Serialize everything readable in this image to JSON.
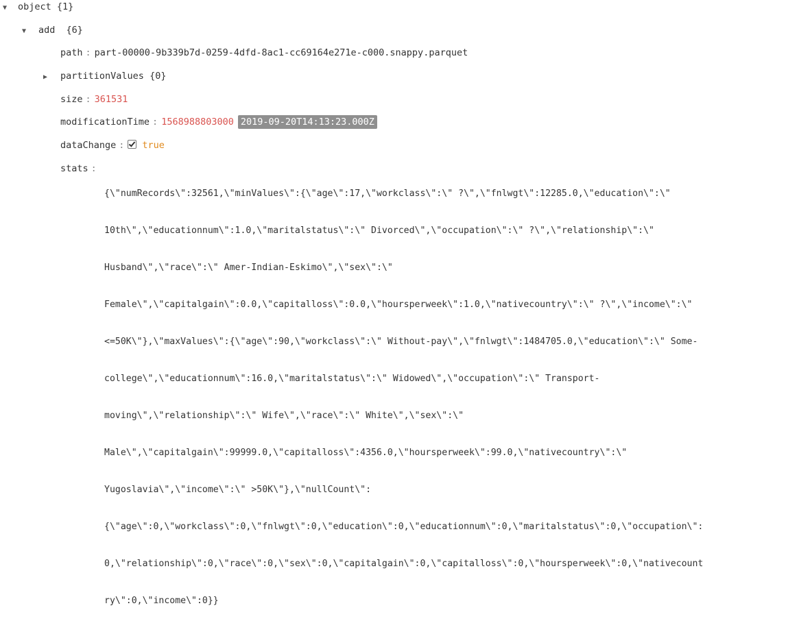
{
  "tree": {
    "root": {
      "key": "object",
      "count": "{1}"
    },
    "add": {
      "key": "add",
      "count": "{6}"
    },
    "path": {
      "key": "path",
      "value": "part-00000-9b339b7d-0259-4dfd-8ac1-cc69164e271e-c000.snappy.parquet"
    },
    "partitionValues": {
      "key": "partitionValues",
      "count": "{0}"
    },
    "size": {
      "key": "size",
      "value": "361531"
    },
    "modificationTime": {
      "key": "modificationTime",
      "value": "1568988803000",
      "date": "2019-09-20T14:13:23.000Z"
    },
    "dataChange": {
      "key": "dataChange",
      "value": "true",
      "checked": true
    },
    "stats": {
      "key": "stats",
      "lines": [
        "{\\\"numRecords\\\":32561,\\\"minValues\\\":{\\\"age\\\":17,\\\"workclass\\\":\\\" ?\\\",\\\"fnlwgt\\\":12285.0,\\\"education\\\":\\\"",
        "10th\\\",\\\"educationnum\\\":1.0,\\\"maritalstatus\\\":\\\" Divorced\\\",\\\"occupation\\\":\\\" ?\\\",\\\"relationship\\\":\\\"",
        "Husband\\\",\\\"race\\\":\\\" Amer-Indian-Eskimo\\\",\\\"sex\\\":\\\"",
        "Female\\\",\\\"capitalgain\\\":0.0,\\\"capitalloss\\\":0.0,\\\"hoursperweek\\\":1.0,\\\"nativecountry\\\":\\\" ?\\\",\\\"income\\\":\\\"",
        "<=50K\\\"},\\\"maxValues\\\":{\\\"age\\\":90,\\\"workclass\\\":\\\" Without-pay\\\",\\\"fnlwgt\\\":1484705.0,\\\"education\\\":\\\" Some-",
        "college\\\",\\\"educationnum\\\":16.0,\\\"maritalstatus\\\":\\\" Widowed\\\",\\\"occupation\\\":\\\" Transport-",
        "moving\\\",\\\"relationship\\\":\\\" Wife\\\",\\\"race\\\":\\\" White\\\",\\\"sex\\\":\\\"",
        "Male\\\",\\\"capitalgain\\\":99999.0,\\\"capitalloss\\\":4356.0,\\\"hoursperweek\\\":99.0,\\\"nativecountry\\\":\\\"",
        "Yugoslavia\\\",\\\"income\\\":\\\" >50K\\\"},\\\"nullCount\\\":",
        "{\\\"age\\\":0,\\\"workclass\\\":0,\\\"fnlwgt\\\":0,\\\"education\\\":0,\\\"educationnum\\\":0,\\\"maritalstatus\\\":0,\\\"occupation\\\":",
        "0,\\\"relationship\\\":0,\\\"race\\\":0,\\\"sex\\\":0,\\\"capitalgain\\\":0,\\\"capitalloss\\\":0,\\\"hoursperweek\\\":0,\\\"nativecount",
        "ry\\\":0,\\\"income\\\":0}}"
      ]
    }
  },
  "icons": {
    "expanded": "triangle-down-icon",
    "collapsed": "triangle-right-icon"
  },
  "colors": {
    "number": "#d9534f",
    "boolean": "#e08a1e",
    "date_badge_bg": "#8f8f8f"
  }
}
